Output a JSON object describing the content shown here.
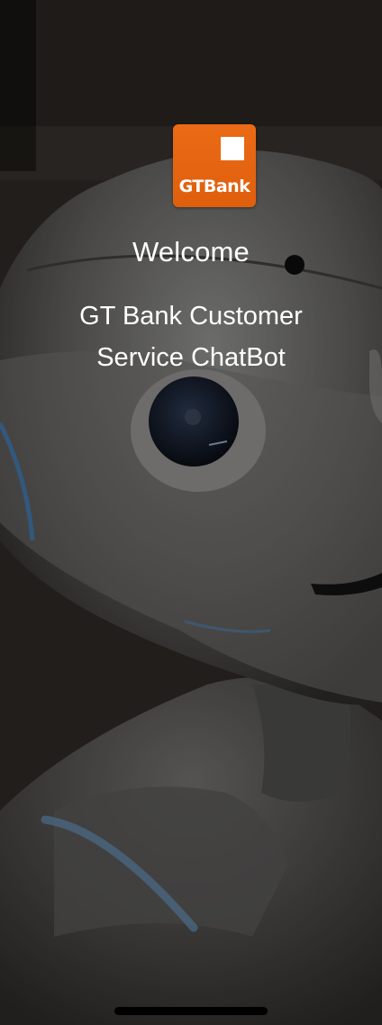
{
  "logo": {
    "text": "GTBank",
    "color": "#e7650f"
  },
  "welcome": "Welcome",
  "subtitle": "GT Bank Customer Service ChatBot",
  "background": {
    "description_icon": "robot-photo-background"
  }
}
